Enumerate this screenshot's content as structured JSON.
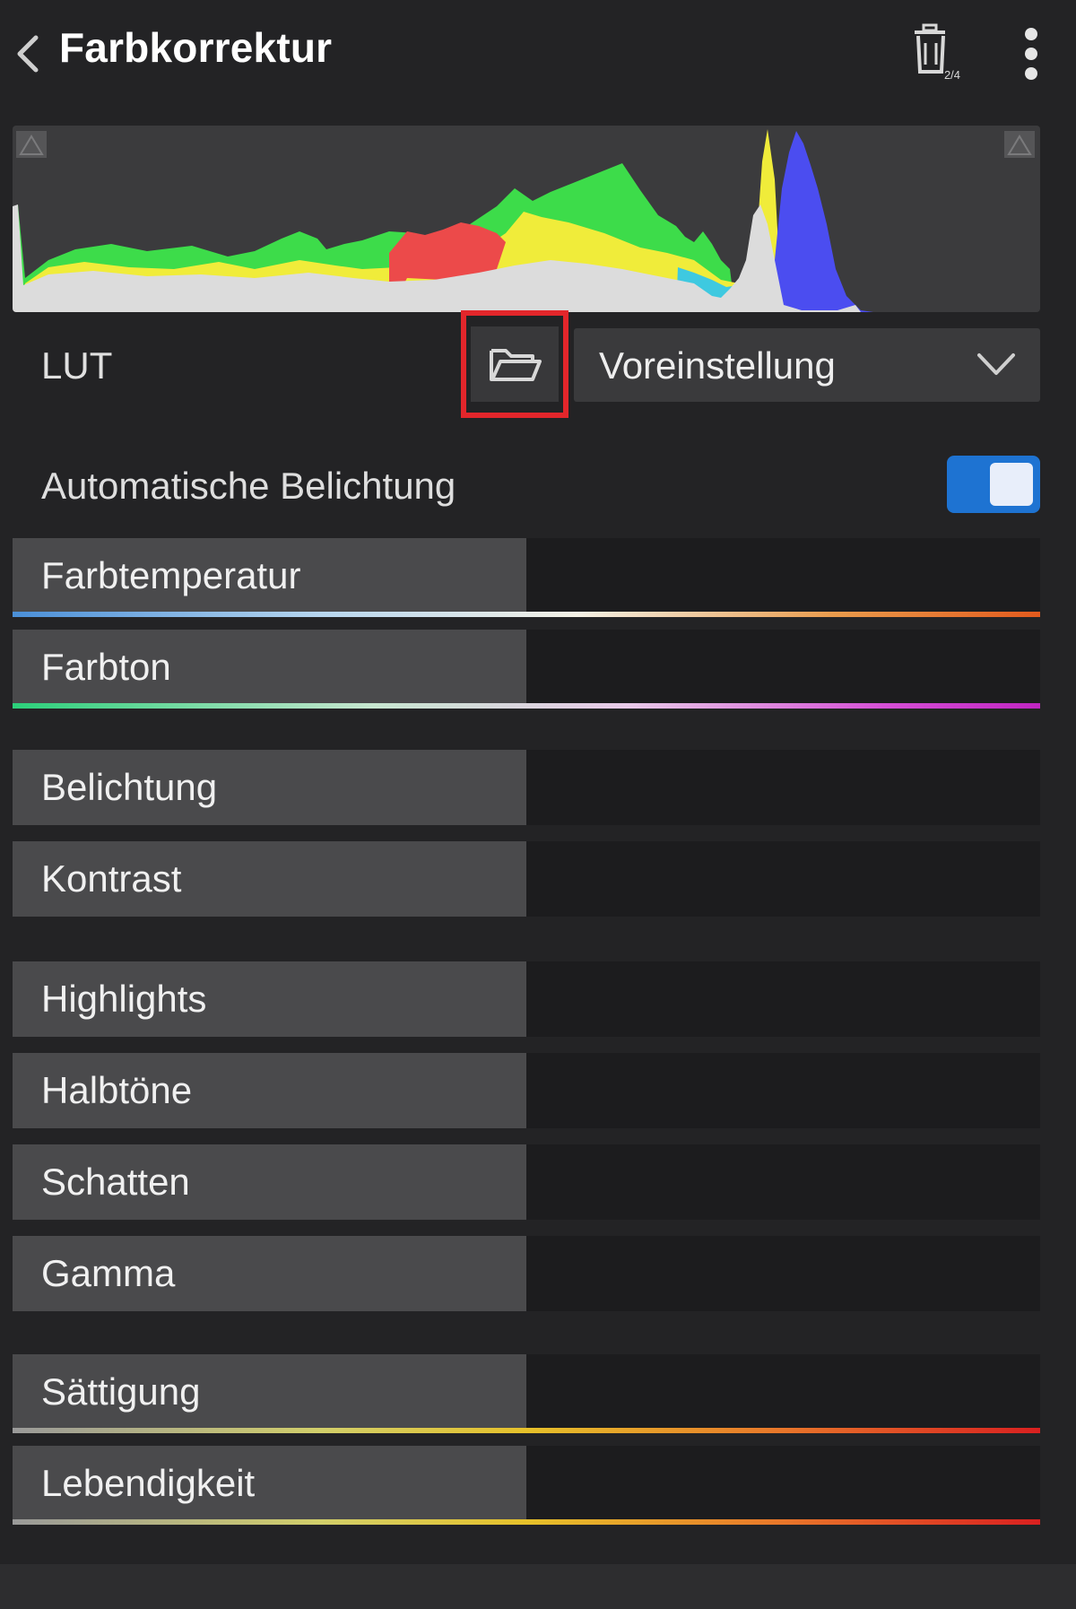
{
  "header": {
    "title": "Farbkorrektur",
    "back_icon": "chevron-left-icon",
    "trash_icon": "trash-icon",
    "trash_badge": "2/4",
    "more_icon": "more-vertical-icon"
  },
  "histogram": {
    "channels": [
      "luminance",
      "red",
      "green",
      "blue",
      "yellow",
      "cyan"
    ]
  },
  "lut": {
    "label": "LUT",
    "folder_icon": "folder-open-icon",
    "selected": "Voreinstellung"
  },
  "auto_exposure": {
    "label": "Automatische Belichtung",
    "enabled": true
  },
  "sliders": [
    {
      "label": "Farbtemperatur",
      "value": 0.5
    },
    {
      "label": "Farbton",
      "value": 0.5
    },
    {
      "label": "Belichtung",
      "value": 0.5
    },
    {
      "label": "Kontrast",
      "value": 0.5
    },
    {
      "label": "Highlights",
      "value": 0.5
    },
    {
      "label": "Halbtöne",
      "value": 0.5
    },
    {
      "label": "Schatten",
      "value": 0.5
    },
    {
      "label": "Gamma",
      "value": 0.5
    },
    {
      "label": "Sättigung",
      "value": 0.5
    },
    {
      "label": "Lebendigkeit",
      "value": 0.5
    }
  ],
  "colors": {
    "accent": "#1e73d2",
    "highlight_box": "#e3262b",
    "background": "#232325"
  }
}
